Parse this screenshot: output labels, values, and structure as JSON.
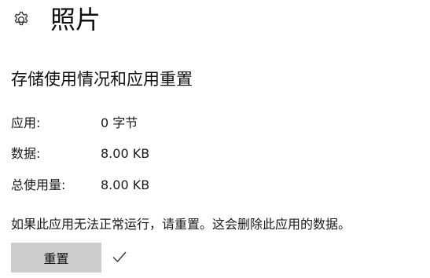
{
  "header": {
    "title": "照片",
    "settings_icon": "gear-icon"
  },
  "storage": {
    "section_title": "存储使用情况和应用重置",
    "rows": [
      {
        "label": "应用:",
        "value": "0 字节"
      },
      {
        "label": "数据:",
        "value": "8.00 KB"
      },
      {
        "label": "总使用量:",
        "value": "8.00 KB"
      }
    ]
  },
  "reset": {
    "description": "如果此应用无法正常运行，请重置。这会删除此应用的数据。",
    "button_label": "重置",
    "status_icon": "checkmark-icon"
  },
  "colors": {
    "button_bg": "#cccccc",
    "text": "#1a1a1a"
  }
}
